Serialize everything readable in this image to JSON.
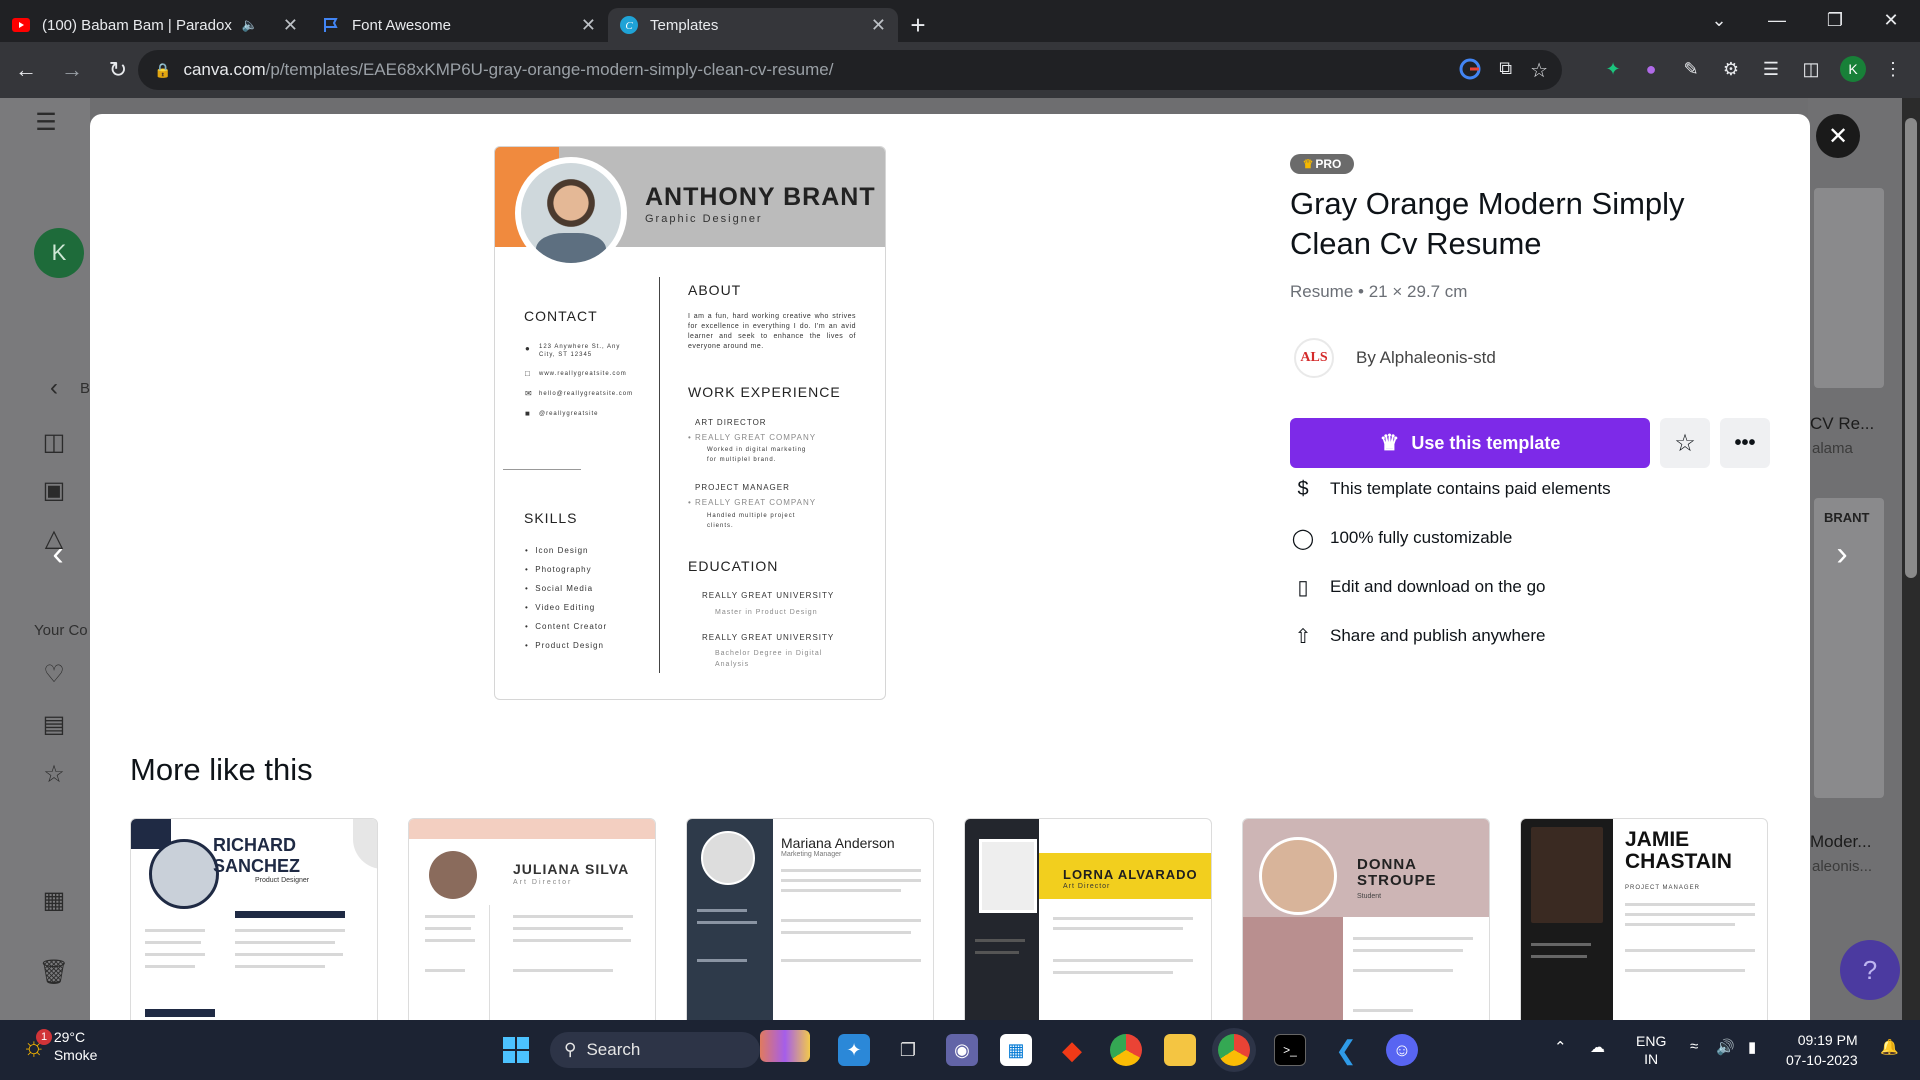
{
  "browser": {
    "tabs": [
      {
        "label": "(100) Babam Bam | Paradox",
        "icon": "youtube-icon",
        "active": false,
        "audio": true
      },
      {
        "label": "Font Awesome",
        "icon": "flag-icon",
        "active": false
      },
      {
        "label": "Templates",
        "icon": "canva-icon",
        "active": true
      }
    ],
    "url_host": "canva.com",
    "url_path": "/p/templates/EAE68xKMP6U-gray-orange-modern-simply-clean-cv-resume/",
    "profile_initial": "K"
  },
  "background": {
    "avatar_initial": "K",
    "sidebar_back": "B",
    "your_content_label": "Your Co",
    "right_card_title": "CV Re...",
    "right_card_sub": "alama",
    "right_card_name": "BRANT",
    "right_card2_title": "Moder...",
    "right_card2_sub": "aleonis..."
  },
  "template": {
    "badge": "PRO",
    "title": "Gray Orange Modern Simply Clean Cv Resume",
    "meta": "Resume • 21 × 29.7 cm",
    "author_logo": "ALS",
    "author": "By Alphaleonis-std",
    "use_button": "Use this template",
    "features": [
      {
        "icon": "dollar-icon",
        "text": "This template contains paid elements"
      },
      {
        "icon": "palette-icon",
        "text": "100% fully customizable"
      },
      {
        "icon": "phone-icon",
        "text": "Edit and download on the go"
      },
      {
        "icon": "share-icon",
        "text": "Share and publish anywhere"
      }
    ]
  },
  "resume": {
    "name": "ANTHONY BRANT",
    "role": "Graphic Designer",
    "contact_heading": "CONTACT",
    "contact": [
      "123 Anywhere St., Any City, ST 12345",
      "www.reallygreatsite.com",
      "hello@reallygreatsite.com",
      "@reallygreatsite"
    ],
    "skills_heading": "SKILLS",
    "skills": [
      "Icon Design",
      "Photography",
      "Social Media",
      "Video Editing",
      "Content Creator",
      "Product Design"
    ],
    "about_heading": "ABOUT",
    "about": "I am a fun, hard working creative who strives for excellence in everything I do. I'm an avid learner and seek to enhance the lives of everyone around me.",
    "work_heading": "WORK EXPERIENCE",
    "work": [
      {
        "title": "ART DIRECTOR",
        "company": "REALLY GREAT COMPANY",
        "desc": "Worked in digital marketing for multiplel brand."
      },
      {
        "title": "PROJECT MANAGER",
        "company": "REALLY GREAT COMPANY",
        "desc": "Handled multiple project clients."
      }
    ],
    "education_heading": "EDUCATION",
    "education": [
      {
        "school": "REALLY GREAT UNIVERSITY",
        "degree": "Master in Product Design"
      },
      {
        "school": "REALLY GREAT UNIVERSITY",
        "degree": "Bachelor Degree in Digital Analysis"
      }
    ]
  },
  "more": {
    "heading": "More like this",
    "cards": [
      {
        "name": "RICHARD SANCHEZ",
        "role": "Product Designer"
      },
      {
        "name": "JULIANA SILVA",
        "role": "Art Director"
      },
      {
        "name": "Mariana Anderson",
        "role": "Marketing Manager"
      },
      {
        "name": "LORNA ALVARADO",
        "role": "Art Director"
      },
      {
        "name": "DONNA STROUPE",
        "role": "Student"
      },
      {
        "name": "JAMIE CHASTAIN",
        "role": "PROJECT MANAGER"
      }
    ]
  },
  "taskbar": {
    "temperature": "29°C",
    "weather": "Smoke",
    "weather_badge": "1",
    "search_label": "Search",
    "lang1": "ENG",
    "lang2": "IN",
    "time": "09:19 PM",
    "date": "07-10-2023"
  },
  "colors": {
    "accent": "#7d2ae8",
    "resume_orange": "#f08a3e",
    "resume_gray": "#bbbbbb"
  }
}
